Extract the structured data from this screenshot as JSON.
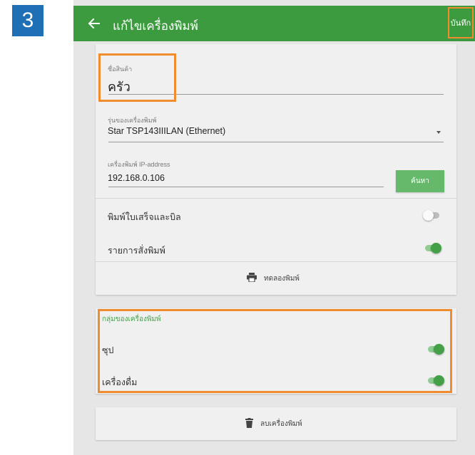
{
  "step_number": "3",
  "appbar": {
    "title": "แก้ไขเครื่องพิมพ์",
    "save_label": "บันทึก",
    "back_icon": "arrow-left-icon",
    "color": "#3c9a3f"
  },
  "form": {
    "product_name": {
      "label": "ชื่อสินค้า",
      "value": "ครัว"
    },
    "printer_model": {
      "label": "รุ่นของเครื่องพิมพ์",
      "value": "Star TSP143IIILAN (Ethernet)"
    },
    "ip_address": {
      "label": "เครื่องพิมพ์ IP-address",
      "value": "192.168.0.106"
    },
    "search_label": "ค้นหา"
  },
  "toggles": [
    {
      "label": "พิมพ์ใบเสร็จและบิล",
      "state": "off"
    },
    {
      "label": "รายการสั่งพิมพ์",
      "state": "on"
    }
  ],
  "test_print": {
    "label": "ทดลองพิมพ์",
    "icon": "printer-icon"
  },
  "printer_groups": {
    "title": "กลุ่มของเครื่องพิมพ์",
    "items": [
      {
        "label": "ซุป",
        "state": "on"
      },
      {
        "label": "เครื่องดื่ม",
        "state": "on"
      }
    ]
  },
  "delete_printer": {
    "label": "ลบเครื่องพิมพ์",
    "icon": "trash-icon"
  },
  "colors": {
    "accent_green": "#43a047",
    "highlight_orange": "#f08c2e",
    "badge_blue": "#1e6fb5"
  }
}
